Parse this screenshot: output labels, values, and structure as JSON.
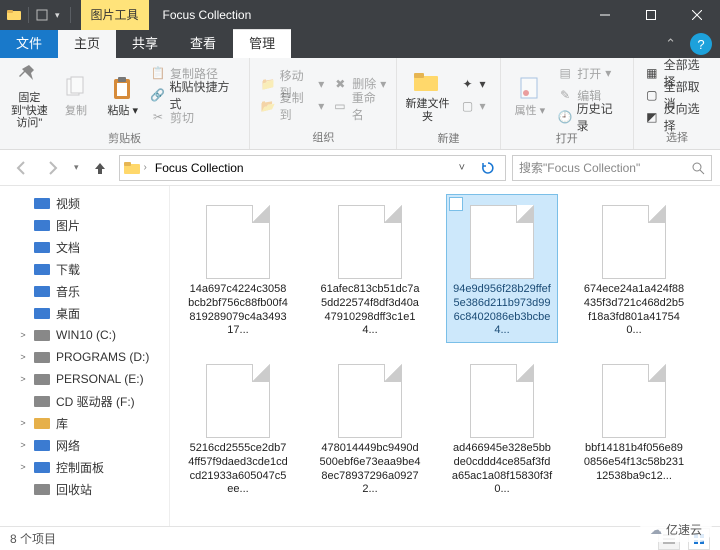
{
  "titlebar": {
    "context_tab": "图片工具",
    "window_title": "Focus Collection"
  },
  "tabs": {
    "file": "文件",
    "home": "主页",
    "share": "共享",
    "view": "查看",
    "manage": "管理"
  },
  "ribbon": {
    "clipboard": {
      "pin": "固定到\"快速访问\"",
      "copy": "复制",
      "paste": "粘贴",
      "copy_path": "复制路径",
      "paste_shortcut": "粘贴快捷方式",
      "cut": "剪切",
      "group": "剪贴板"
    },
    "organize": {
      "move_to": "移动到",
      "copy_to": "复制到",
      "delete": "删除",
      "rename": "重命名",
      "group": "组织"
    },
    "new": {
      "new_folder": "新建文件夹",
      "group": "新建"
    },
    "open": {
      "properties": "属性",
      "open": "打开",
      "edit": "编辑",
      "history": "历史记录",
      "group": "打开"
    },
    "select": {
      "select_all": "全部选择",
      "select_none": "全部取消",
      "invert": "反向选择",
      "group": "选择"
    }
  },
  "address": {
    "crumb": "Focus Collection"
  },
  "search": {
    "placeholder": "搜索\"Focus Collection\""
  },
  "tree": [
    {
      "label": "视频",
      "icon": "video-icon",
      "color": "#3b7bd1"
    },
    {
      "label": "图片",
      "icon": "image-icon",
      "color": "#3b7bd1"
    },
    {
      "label": "文档",
      "icon": "doc-icon",
      "color": "#3b7bd1"
    },
    {
      "label": "下载",
      "icon": "download-icon",
      "color": "#3b7bd1"
    },
    {
      "label": "音乐",
      "icon": "music-icon",
      "color": "#3b7bd1"
    },
    {
      "label": "桌面",
      "icon": "desktop-icon",
      "color": "#3b7bd1"
    },
    {
      "label": "WIN10 (C:)",
      "icon": "drive-icon",
      "color": "#888",
      "exp": ">"
    },
    {
      "label": "PROGRAMS (D:)",
      "icon": "drive-icon",
      "color": "#888",
      "exp": ">"
    },
    {
      "label": "PERSONAL (E:)",
      "icon": "drive-icon",
      "color": "#888",
      "exp": ">"
    },
    {
      "label": "CD 驱动器 (F:)",
      "icon": "cd-icon",
      "color": "#888"
    },
    {
      "label": "库",
      "icon": "library-icon",
      "color": "#e6b04a",
      "exp": ">"
    },
    {
      "label": "网络",
      "icon": "network-icon",
      "color": "#3b7bd1",
      "exp": ">"
    },
    {
      "label": "控制面板",
      "icon": "control-icon",
      "color": "#3b7bd1",
      "exp": ">"
    },
    {
      "label": "回收站",
      "icon": "recycle-icon",
      "color": "#888"
    }
  ],
  "files": [
    {
      "name": "14a697c4224c3058bcb2bf756c88fb00f4819289079c4a349317..."
    },
    {
      "name": "61afec813cb51dc7a5dd22574f8df3d40a47910298dff3c1e14..."
    },
    {
      "name": "94e9d956f28b29ffef5e386d211b973d996c8402086eb3bcbe4...",
      "selected": true
    },
    {
      "name": "674ece24a1a424f88435f3d721c468d2b5f18a3fd801a417540..."
    },
    {
      "name": "5216cd2555ce2db74ff57f9daed3cde1cdcd21933a605047c5ee..."
    },
    {
      "name": "478014449bc9490d500ebf6e73eaa9be48ec78937296a09272..."
    },
    {
      "name": "ad466945e328e5bbde0cddd4ce85af3fda65ac1a08f15830f3f0..."
    },
    {
      "name": "bbf14181b4f056e890856e54f13c58b23112538ba9c12..."
    }
  ],
  "status": {
    "count": "8 个项目"
  },
  "watermark": "亿速云"
}
